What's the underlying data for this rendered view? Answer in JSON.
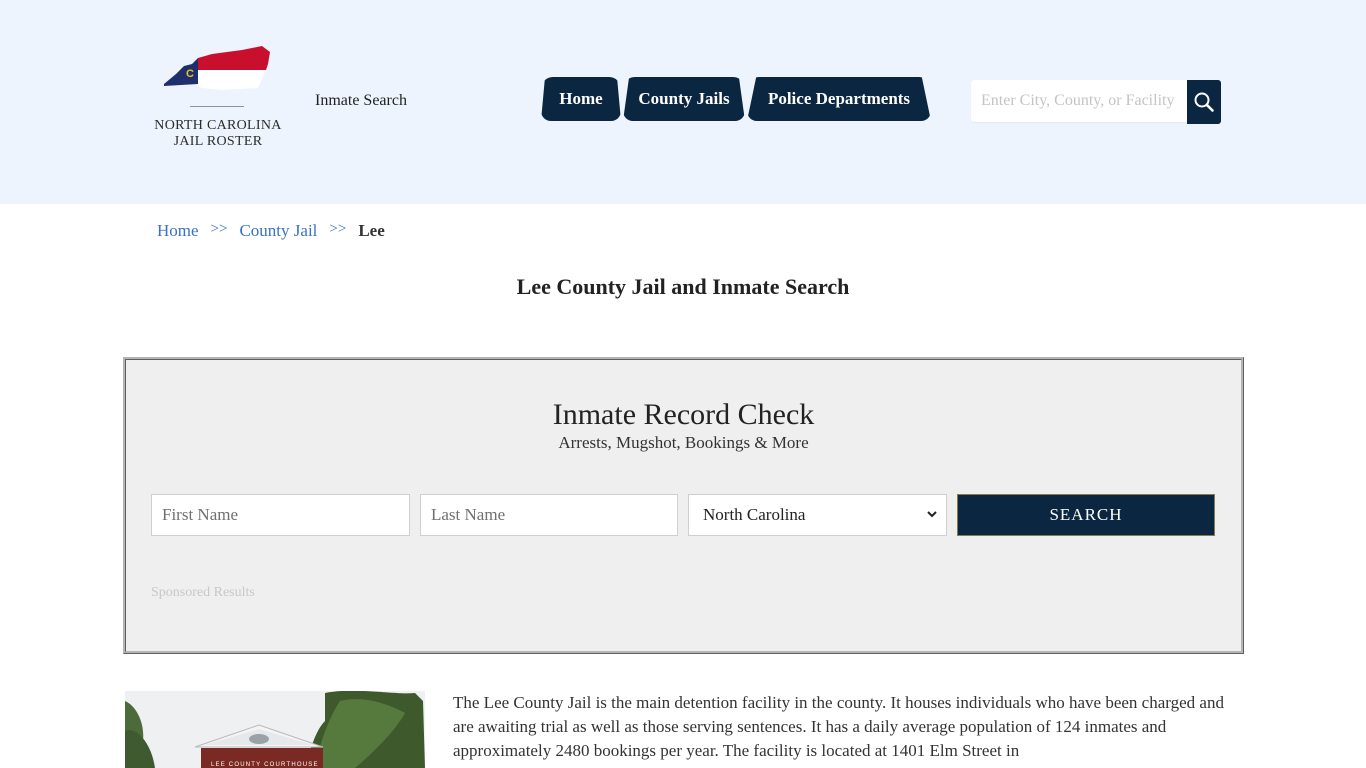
{
  "header": {
    "logo": {
      "line1": "NORTH CAROLINA",
      "line2": "JAIL ROSTER",
      "dots": "•••",
      "icon": "nc-flag-state-map-icon",
      "flag_colors": {
        "red": "#c8102e",
        "blue": "#1f2f6b",
        "white": "#ffffff",
        "gold": "#e8c420"
      }
    },
    "inmate_search_link": "Inmate Search",
    "nav": [
      {
        "label": "Home"
      },
      {
        "label": "County Jails"
      },
      {
        "label": "Police Departments"
      }
    ],
    "search": {
      "placeholder": "Enter City, County, or Facility",
      "value": "",
      "button_icon": "magnifier-icon"
    }
  },
  "breadcrumb": {
    "items": [
      {
        "label": "Home"
      },
      {
        "label": "County Jail"
      }
    ],
    "separator": ">>",
    "current": "Lee"
  },
  "page_title": "Lee County Jail and Inmate Search",
  "record_check": {
    "title": "Inmate Record Check",
    "subtitle": "Arrests, Mugshot, Bookings & More",
    "first_name": {
      "placeholder": "First Name",
      "value": ""
    },
    "last_name": {
      "placeholder": "Last Name",
      "value": ""
    },
    "state": {
      "selected": "North Carolina"
    },
    "search_button": "SEARCH",
    "sponsored": "Sponsored Results"
  },
  "content": {
    "image_alt": "Lee County Courthouse",
    "image_sign_text": "LEE COUNTY COURTHOUSE",
    "intro": "The Lee County Jail is the main detention facility in the county. It houses individuals who have been charged and are awaiting trial as well as those serving sentences. It has a daily average population of 124 inmates and approximately 2480 bookings per year. The facility is located at 1401 Elm Street in"
  },
  "colors": {
    "header_bg": "#edf4fd",
    "navy": "#0b2640",
    "link": "#3a70c8",
    "panel_bg": "#efefef"
  }
}
